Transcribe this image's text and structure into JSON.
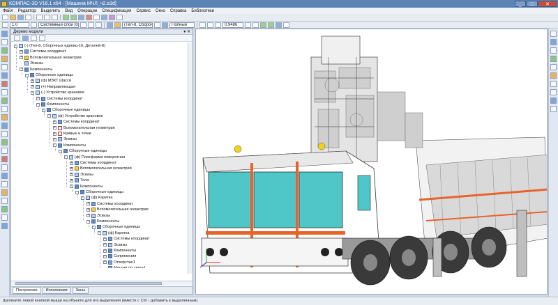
{
  "window": {
    "title": "КОМПАС-3D V16.1 x64 - [Машина МЧЛ_ч2.a3d]",
    "controls": [
      "_",
      "□",
      "✕"
    ]
  },
  "menu": [
    "Файл",
    "Редактор",
    "Выделить",
    "Вид",
    "Операции",
    "Спецификация",
    "Сервис",
    "Окно",
    "Справка",
    "Библиотеки"
  ],
  "toolbar": {
    "scale_value": "1.0",
    "layer_value": "Системный слой (0)",
    "view_value": "(Тел-8, Сборочн",
    "render_mode": "Полный",
    "zoom_value": "0.9486"
  },
  "tree": {
    "panel_title": "Дерево модели",
    "header_buttons": "▾ ✕",
    "rows": [
      {
        "label": "(-) (Тел-8, Сборочных единиц-16, Деталей-8)",
        "icon": "part",
        "level": 0,
        "twisty": "-"
      },
      {
        "label": "Системы координат",
        "icon": "sys",
        "level": 1,
        "twisty": "+"
      },
      {
        "label": "Вспомогательная геометрия",
        "icon": "ax",
        "level": 1,
        "twisty": "+"
      },
      {
        "label": "Эскизы",
        "icon": "sk",
        "level": 1,
        "twisty": ""
      },
      {
        "label": "Компоненты",
        "icon": "comp",
        "level": 1,
        "twisty": "-"
      },
      {
        "label": "Сборочные единицы",
        "icon": "comp",
        "level": 2,
        "twisty": "-"
      },
      {
        "label": "(ф) МЗКТ Шасси",
        "icon": "part",
        "level": 3,
        "twisty": "+"
      },
      {
        "label": "(+) Направляющая",
        "icon": "part",
        "level": 3,
        "twisty": "+"
      },
      {
        "label": "(-) Устройство крановое",
        "icon": "part",
        "level": 3,
        "twisty": "-"
      },
      {
        "label": "Системы координат",
        "icon": "sys",
        "level": 4,
        "twisty": "+"
      },
      {
        "label": "Компоненты",
        "icon": "comp",
        "level": 4,
        "twisty": "-"
      },
      {
        "label": "Сборочные единицы",
        "icon": "comp",
        "level": 5,
        "twisty": "-"
      },
      {
        "label": "(ф) Устройство крановое",
        "icon": "part",
        "level": 6,
        "twisty": "-"
      },
      {
        "label": "Системы координат",
        "icon": "sys",
        "level": 7,
        "twisty": "+"
      },
      {
        "label": "Вспомогательная геометрия",
        "icon": "x",
        "level": 7,
        "twisty": "+"
      },
      {
        "label": "Кривые и точки",
        "icon": "x",
        "level": 7,
        "twisty": "+"
      },
      {
        "label": "Эскизы",
        "icon": "sk",
        "level": 7,
        "twisty": "+"
      },
      {
        "label": "Компоненты",
        "icon": "comp",
        "level": 7,
        "twisty": "-"
      },
      {
        "label": "Сборочные единицы",
        "icon": "comp",
        "level": 8,
        "twisty": "-"
      },
      {
        "label": "(ф) Платформа поворотная",
        "icon": "part",
        "level": 9,
        "twisty": "-"
      },
      {
        "label": "Системы координат",
        "icon": "sys",
        "level": 10,
        "twisty": "+"
      },
      {
        "label": "Вспомогательная геометрия",
        "icon": "ax",
        "level": 10,
        "twisty": "+"
      },
      {
        "label": "Эскизы",
        "icon": "sk",
        "level": 10,
        "twisty": "+"
      },
      {
        "label": "Тела",
        "icon": "body",
        "level": 10,
        "twisty": "+"
      },
      {
        "label": "Компоненты",
        "icon": "comp",
        "level": 10,
        "twisty": "-"
      },
      {
        "label": "Сборочные единицы",
        "icon": "comp",
        "level": 11,
        "twisty": "-"
      },
      {
        "label": "(ф) Каретка",
        "icon": "part",
        "level": 12,
        "twisty": "-"
      },
      {
        "label": "Системы координат",
        "icon": "sys",
        "level": 13,
        "twisty": "+"
      },
      {
        "label": "Вспомогательная геометрия",
        "icon": "ax",
        "level": 13,
        "twisty": "+"
      },
      {
        "label": "Эскизы",
        "icon": "sk",
        "level": 13,
        "twisty": "+"
      },
      {
        "label": "Компоненты",
        "icon": "comp",
        "level": 13,
        "twisty": "-"
      },
      {
        "label": "Сборочные единицы",
        "icon": "comp",
        "level": 14,
        "twisty": "-"
      },
      {
        "label": "(ф) Каретка",
        "icon": "part",
        "level": 15,
        "twisty": "-"
      },
      {
        "label": "Системы координат",
        "icon": "sys",
        "level": 16,
        "twisty": "+"
      },
      {
        "label": "Эскизы",
        "icon": "sk",
        "level": 16,
        "twisty": "+"
      },
      {
        "label": "Компоненты",
        "icon": "comp",
        "level": 16,
        "twisty": "+"
      },
      {
        "label": "Сопряжения",
        "icon": "comp",
        "level": 16,
        "twisty": "+"
      },
      {
        "label": "Отверстие1",
        "icon": "body",
        "level": 16,
        "twisty": "+"
      },
      {
        "label": "Массив по сетке1",
        "icon": "body",
        "level": 16,
        "twisty": ""
      }
    ],
    "tabs": [
      "Построение",
      "Исполнения",
      "Зоны"
    ]
  },
  "status": {
    "text": "Щелкните левой кнопкой мыши на объекте для его выделения (вместе с Ctrl - добавить к выделенным)"
  },
  "colors": {
    "titlebar": "#5c83b6",
    "cab_glass": "#4fc6c8",
    "stripe": "#e8632a",
    "beacon": "#f2d21a",
    "truck_body": "#ffffff",
    "tire": "#3a3a3a"
  }
}
